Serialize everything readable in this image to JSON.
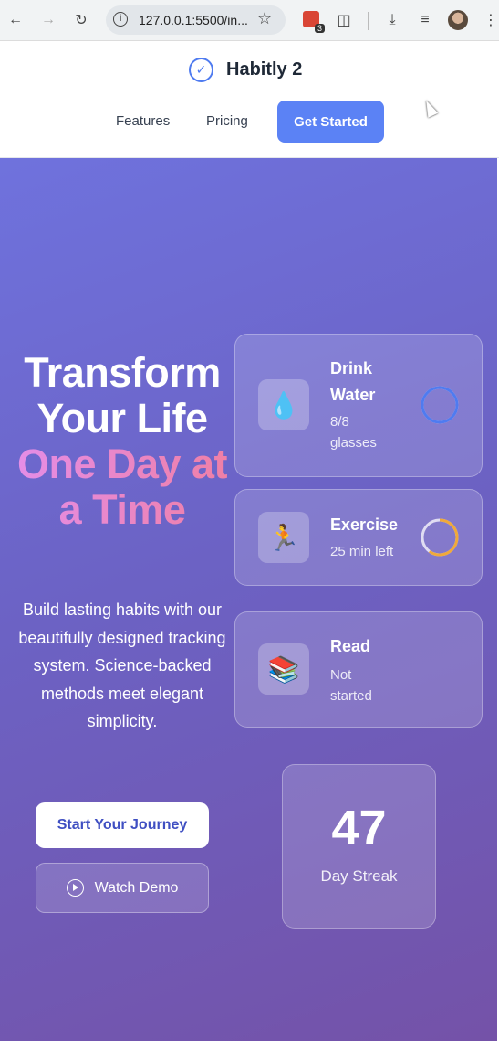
{
  "browser": {
    "url": "127.0.0.1:5500/in...",
    "extension_badge_count": "3"
  },
  "nav": {
    "brand": "Habitly 2",
    "links": [
      "Features",
      "Pricing"
    ],
    "cta": "Get Started"
  },
  "hero": {
    "headline_line1": "Transform",
    "headline_line2": "Your Life",
    "headline_accent1": "One Day at",
    "headline_accent2": "a Time",
    "subtitle": "Build lasting habits with our beautifully designed tracking system. Science-backed methods meet elegant simplicity.",
    "primary_button": "Start Your Journey",
    "secondary_button": "Watch Demo"
  },
  "habits": [
    {
      "icon": "💧",
      "title_line1": "Drink",
      "title_line2": "Water",
      "status_line1": "8/8",
      "status_line2": "glasses",
      "progress": 1.0,
      "ring_color": "#4f7bf0"
    },
    {
      "icon": "🏃",
      "title_line1": "Exercise",
      "title_line2": "",
      "status_line1": "25 min left",
      "status_line2": "",
      "progress": 0.6,
      "ring_color": "#f0a93a"
    },
    {
      "icon": "📚",
      "title_line1": "Read",
      "title_line2": "",
      "status_line1": "Not",
      "status_line2": "started",
      "progress": 0,
      "ring_color": "#ffffff"
    }
  ],
  "streak": {
    "value": "47",
    "label": "Day Streak"
  }
}
